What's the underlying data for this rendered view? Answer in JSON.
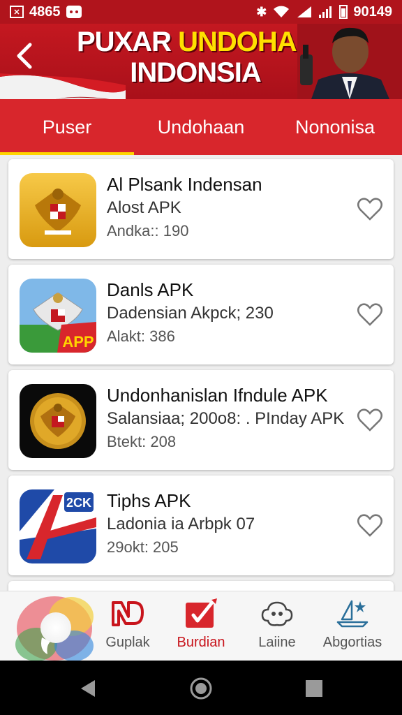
{
  "status_bar": {
    "left_text": "4865",
    "time": "90149",
    "icons": [
      "notification-box-icon",
      "message-icon",
      "bluetooth-icon",
      "wifi-icon",
      "signal-icon",
      "battery-icon"
    ]
  },
  "header": {
    "title_part1": "PUXAR ",
    "title_part2": "UNDOHAN",
    "title_line2": "INDONSIA"
  },
  "tabs": [
    {
      "label": "Puser",
      "active": true
    },
    {
      "label": "Undohaan",
      "active": false
    },
    {
      "label": "Nononisa",
      "active": false
    }
  ],
  "apps": [
    {
      "name": "Al  Plsank Indensan",
      "sub": "Alost APK",
      "meta": "Andka:: 190",
      "icon": "garuda-gold-icon"
    },
    {
      "name": "Danls APK",
      "sub": "Dadensian Akpck; 230",
      "meta": "Alakt: 386",
      "icon": "garuda-app-icon",
      "badge": "APP"
    },
    {
      "name": "Undonhanislan Ifndule APK",
      "sub": "Salansiaa; 200o8:  .  PInday APK",
      "meta": "Btekt: 208",
      "icon": "garuda-emblem-icon"
    },
    {
      "name": "Tiphs APK",
      "sub": "Ladonia ia Arbpk 07",
      "meta": "29okt: 205",
      "icon": "letter-a-icon",
      "badge": "2CK"
    }
  ],
  "bottom_nav": [
    {
      "label": "Guplak",
      "icon": "nd-logo-icon"
    },
    {
      "label": "Burdian",
      "icon": "edit-box-icon",
      "active": true
    },
    {
      "label": "Laiine",
      "icon": "cloud-icon"
    },
    {
      "label": "Abgortias",
      "icon": "boat-icon"
    }
  ],
  "colors": {
    "primary_red": "#c41820",
    "tab_red": "#d8262c",
    "accent_yellow": "#ffd400",
    "active_nav": "#c8141c"
  }
}
